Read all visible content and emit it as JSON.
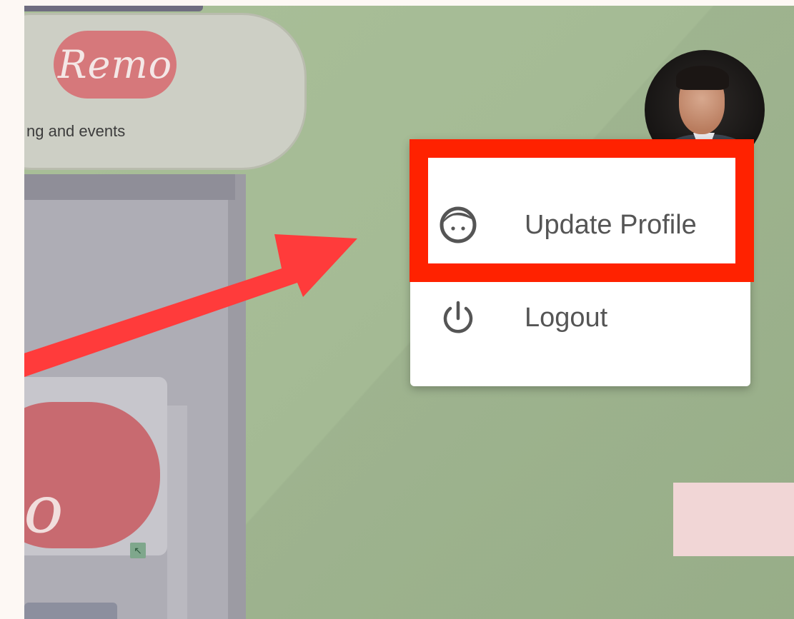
{
  "logo": {
    "brand_text": "Remo",
    "tagline": "ng and events"
  },
  "preview": {
    "brand_text_partial": "no"
  },
  "profile_menu": {
    "items": [
      {
        "label": "Update Profile",
        "icon": "face-icon"
      },
      {
        "label": "Logout",
        "icon": "power-icon"
      }
    ]
  },
  "colors": {
    "highlight": "#ff2200",
    "arrow": "#ff3b3b",
    "brand": "#d6787b",
    "canvas": "#a9bf98"
  }
}
